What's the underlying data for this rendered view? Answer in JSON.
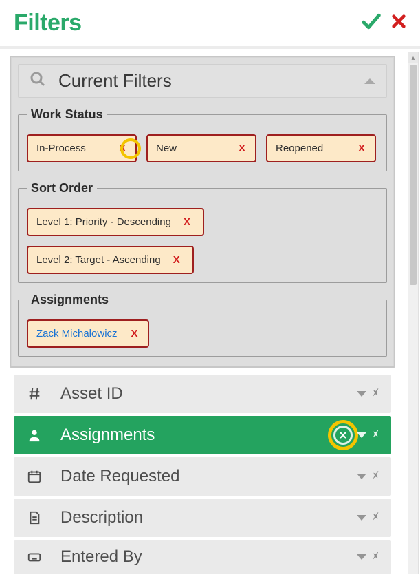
{
  "header": {
    "title": "Filters"
  },
  "panel": {
    "title": "Current Filters"
  },
  "groups": {
    "work_status": {
      "legend": "Work Status",
      "chips": [
        "In-Process",
        "New",
        "Reopened"
      ]
    },
    "sort_order": {
      "legend": "Sort Order",
      "chips": [
        "Level 1: Priority - Descending",
        "Level 2: Target - Ascending"
      ]
    },
    "assignments": {
      "legend": "Assignments",
      "chips": [
        "Zack Michalowicz"
      ]
    }
  },
  "remove_label": "X",
  "fields": [
    {
      "label": "Asset ID",
      "icon": "hash",
      "active": false
    },
    {
      "label": "Assignments",
      "icon": "user",
      "active": true
    },
    {
      "label": "Date Requested",
      "icon": "calendar",
      "active": false
    },
    {
      "label": "Description",
      "icon": "file",
      "active": false
    },
    {
      "label": "Entered By",
      "icon": "keyboard",
      "active": false
    }
  ]
}
